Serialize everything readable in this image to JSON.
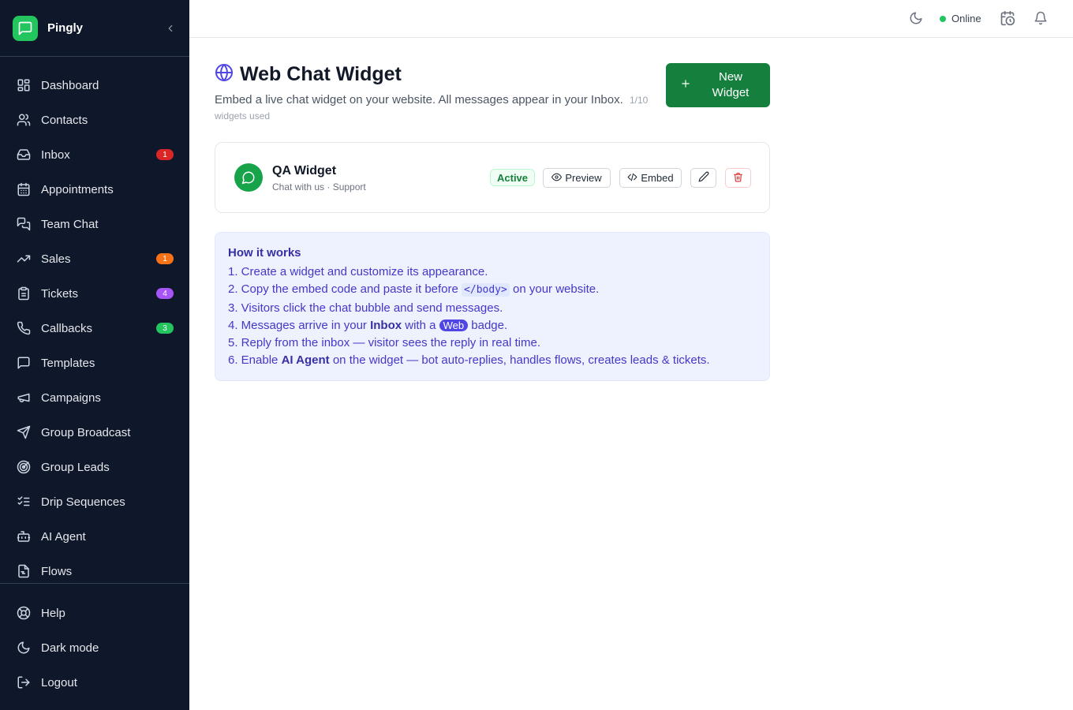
{
  "app": {
    "name": "Pingly"
  },
  "sidebar": {
    "items": [
      {
        "label": "Dashboard",
        "icon": "dashboard-icon"
      },
      {
        "label": "Contacts",
        "icon": "contacts-icon"
      },
      {
        "label": "Inbox",
        "icon": "inbox-icon",
        "badge": "1",
        "badge_color": "#dc2626"
      },
      {
        "label": "Appointments",
        "icon": "calendar-icon"
      },
      {
        "label": "Team Chat",
        "icon": "team-chat-icon"
      },
      {
        "label": "Sales",
        "icon": "trending-up-icon",
        "badge": "1",
        "badge_color": "#f97316"
      },
      {
        "label": "Tickets",
        "icon": "clipboard-icon",
        "badge": "4",
        "badge_color": "#a855f7"
      },
      {
        "label": "Callbacks",
        "icon": "phone-icon",
        "badge": "3",
        "badge_color": "#22c55e"
      },
      {
        "label": "Templates",
        "icon": "message-square-icon"
      },
      {
        "label": "Campaigns",
        "icon": "megaphone-icon"
      },
      {
        "label": "Group Broadcast",
        "icon": "send-icon"
      },
      {
        "label": "Group Leads",
        "icon": "radar-icon"
      },
      {
        "label": "Drip Sequences",
        "icon": "list-checks-icon"
      },
      {
        "label": "AI Agent",
        "icon": "bot-icon"
      },
      {
        "label": "Flows",
        "icon": "flows-icon"
      }
    ],
    "bottom": [
      {
        "label": "Help",
        "icon": "life-buoy-icon"
      },
      {
        "label": "Dark mode",
        "icon": "moon-icon"
      },
      {
        "label": "Logout",
        "icon": "logout-icon"
      }
    ]
  },
  "topbar": {
    "status": "Online",
    "status_color": "#22c55e"
  },
  "page": {
    "title": "Web Chat Widget",
    "subtitle": "Embed a live chat widget on your website. All messages appear in your Inbox.",
    "usage": "1/10 widgets used",
    "new_button": "New Widget"
  },
  "widget": {
    "name": "QA Widget",
    "subtitle": "Chat with us · Support",
    "status": "Active",
    "preview_label": "Preview",
    "embed_label": "Embed"
  },
  "how_it_works": {
    "title": "How it works",
    "s1": "1. Create a widget and customize its appearance.",
    "s2_a": "2. Copy the embed code and paste it before",
    "s2_code": "</body>",
    "s2_b": "on your website.",
    "s3": "3. Visitors click the chat bubble and send messages.",
    "s4_a": "4. Messages arrive in your",
    "s4_bold": "Inbox",
    "s4_b": "with a",
    "s4_pill": "Web",
    "s4_c": "badge.",
    "s5": "5. Reply from the inbox — visitor sees the reply in real time.",
    "s6_a": "6. Enable",
    "s6_bold": "AI Agent",
    "s6_b": "on the widget — bot auto-replies, handles flows, creates leads & tickets."
  },
  "colors": {
    "sidebar_bg": "#0f172a",
    "accent": "#15803d",
    "brand": "#22c55e",
    "info_bg": "#eef2ff"
  }
}
